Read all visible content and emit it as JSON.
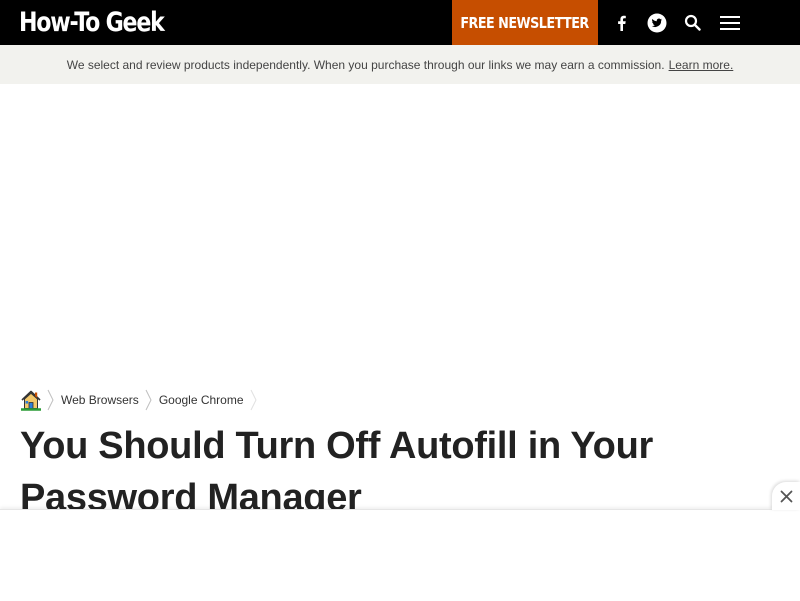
{
  "header": {
    "logo_text": "How-To Geek",
    "newsletter_label": "FREE NEWSLETTER",
    "icons": [
      "facebook-icon",
      "twitter-icon",
      "search-icon",
      "menu-icon"
    ],
    "background_color": "#000000",
    "accent_color": "#c64e00"
  },
  "disclosure": {
    "text": "We select and review products independently. When you purchase through our links we may earn a commission.",
    "link_label": "Learn more."
  },
  "breadcrumb": {
    "home_icon": "home-icon",
    "items": [
      {
        "label": "Web Browsers"
      },
      {
        "label": "Google Chrome"
      }
    ]
  },
  "article": {
    "title": "You Should Turn Off Autofill in Your Password Manager"
  },
  "ad_banner": {
    "close_icon": "close-icon"
  }
}
